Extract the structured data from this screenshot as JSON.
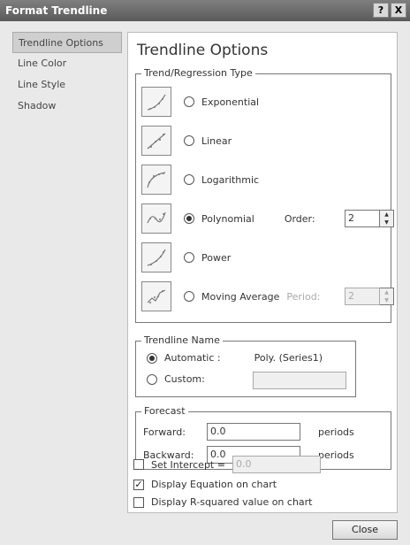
{
  "window": {
    "title": "Format Trendline",
    "help_label": "?",
    "close_label": "X"
  },
  "nav": [
    {
      "label": "Trendline Options",
      "selected": true
    },
    {
      "label": "Line Color",
      "selected": false
    },
    {
      "label": "Line Style",
      "selected": false
    },
    {
      "label": "Shadow",
      "selected": false
    }
  ],
  "panel": {
    "title": "Trendline Options"
  },
  "trend_type": {
    "legend": "Trend/Regression Type",
    "options": [
      {
        "label": "Exponential",
        "selected": false,
        "icon": "exponential-trend-icon"
      },
      {
        "label": "Linear",
        "selected": false,
        "icon": "linear-trend-icon"
      },
      {
        "label": "Logarithmic",
        "selected": false,
        "icon": "logarithmic-trend-icon"
      },
      {
        "label": "Polynomial",
        "selected": true,
        "icon": "polynomial-trend-icon"
      },
      {
        "label": "Power",
        "selected": false,
        "icon": "power-trend-icon"
      },
      {
        "label": "Moving Average",
        "selected": false,
        "icon": "moving-average-trend-icon"
      }
    ],
    "order_label": "Order:",
    "order_value": "2",
    "period_label": "Period:",
    "period_value": "2"
  },
  "trendline_name": {
    "legend": "Trendline Name",
    "automatic_label": "Automatic :",
    "automatic_value": "Poly. (Series1)",
    "custom_label": "Custom:",
    "custom_value": ""
  },
  "forecast": {
    "legend": "Forecast",
    "forward_label": "Forward:",
    "forward_value": "0.0",
    "backward_label": "Backward:",
    "backward_value": "0.0",
    "unit": "periods"
  },
  "options": {
    "set_intercept_label": "Set Intercept =",
    "set_intercept_value": "0.0",
    "set_intercept_checked": false,
    "display_equation_label": "Display Equation on chart",
    "display_equation_checked": true,
    "display_r2_label": "Display R-squared value on chart",
    "display_r2_checked": false
  },
  "footer": {
    "close_label": "Close"
  },
  "colors": {
    "titlebar": "#5a5a5a",
    "panel_bg": "#ffffff",
    "dialog_bg": "#e9e9e9"
  }
}
